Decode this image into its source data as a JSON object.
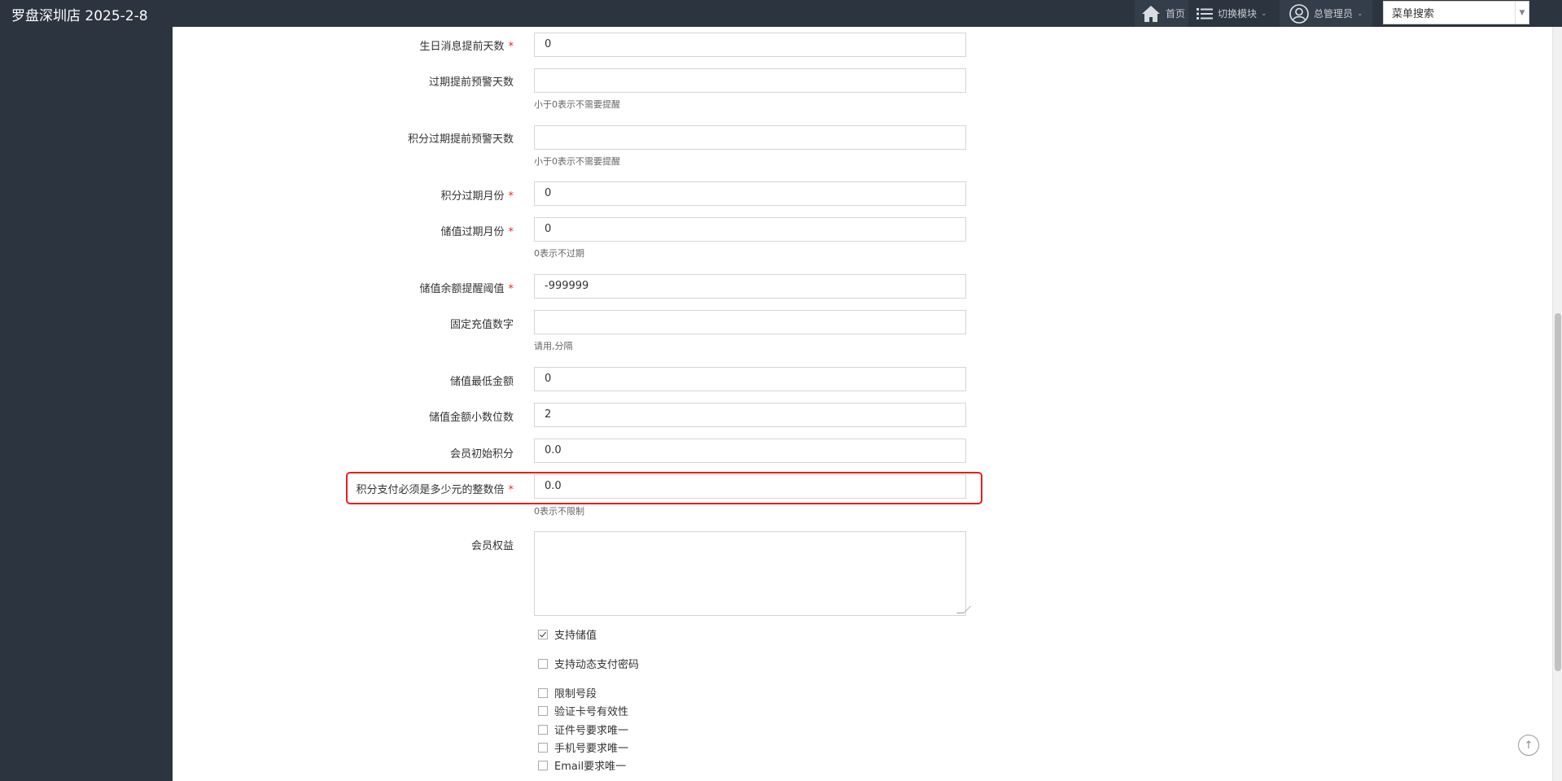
{
  "app": {
    "title": "罗盘深圳店 2025-2-8"
  },
  "nav": {
    "home": "首页",
    "switch_module": "切换模块",
    "admin": "总管理员",
    "menu_search": "菜单搜索"
  },
  "form": {
    "birthday_days": {
      "label": "生日消息提前天数",
      "value": "0"
    },
    "expire_warn_days": {
      "label": "过期提前预警天数",
      "value": "",
      "help": "小于0表示不需要提醒"
    },
    "points_expire_warn_days": {
      "label": "积分过期提前预警天数",
      "value": "",
      "help": "小于0表示不需要提醒"
    },
    "points_expire_months": {
      "label": "积分过期月份",
      "value": "0"
    },
    "stored_expire_months": {
      "label": "储值过期月份",
      "value": "0",
      "help": "0表示不过期"
    },
    "balance_threshold": {
      "label": "储值余额提醒阈值",
      "value": "-999999"
    },
    "fixed_recharge": {
      "label": "固定充值数字",
      "value": "",
      "help": "请用,分隔"
    },
    "min_stored_amount": {
      "label": "储值最低金额",
      "value": "0"
    },
    "decimal_places": {
      "label": "储值金额小数位数",
      "value": "2"
    },
    "initial_points": {
      "label": "会员初始积分",
      "value": "0.0"
    },
    "points_multiple": {
      "label": "积分支付必须是多少元的整数倍",
      "value": "0.0",
      "help": "0表示不限制"
    },
    "member_rights": {
      "label": "会员权益",
      "value": ""
    },
    "required_mark": "*"
  },
  "checks": [
    {
      "label": "支持储值",
      "checked": true
    },
    {
      "label": "支持动态支付密码",
      "checked": false
    },
    {
      "label": "限制号段",
      "checked": false
    },
    {
      "label": "验证卡号有效性",
      "checked": false
    },
    {
      "label": "证件号要求唯一",
      "checked": false
    },
    {
      "label": "手机号要求唯一",
      "checked": false
    },
    {
      "label": "Email要求唯一",
      "checked": false
    }
  ],
  "colors": {
    "navbar": "#2c3440",
    "required": "#e02d2d",
    "highlight": "#e81e1e"
  }
}
